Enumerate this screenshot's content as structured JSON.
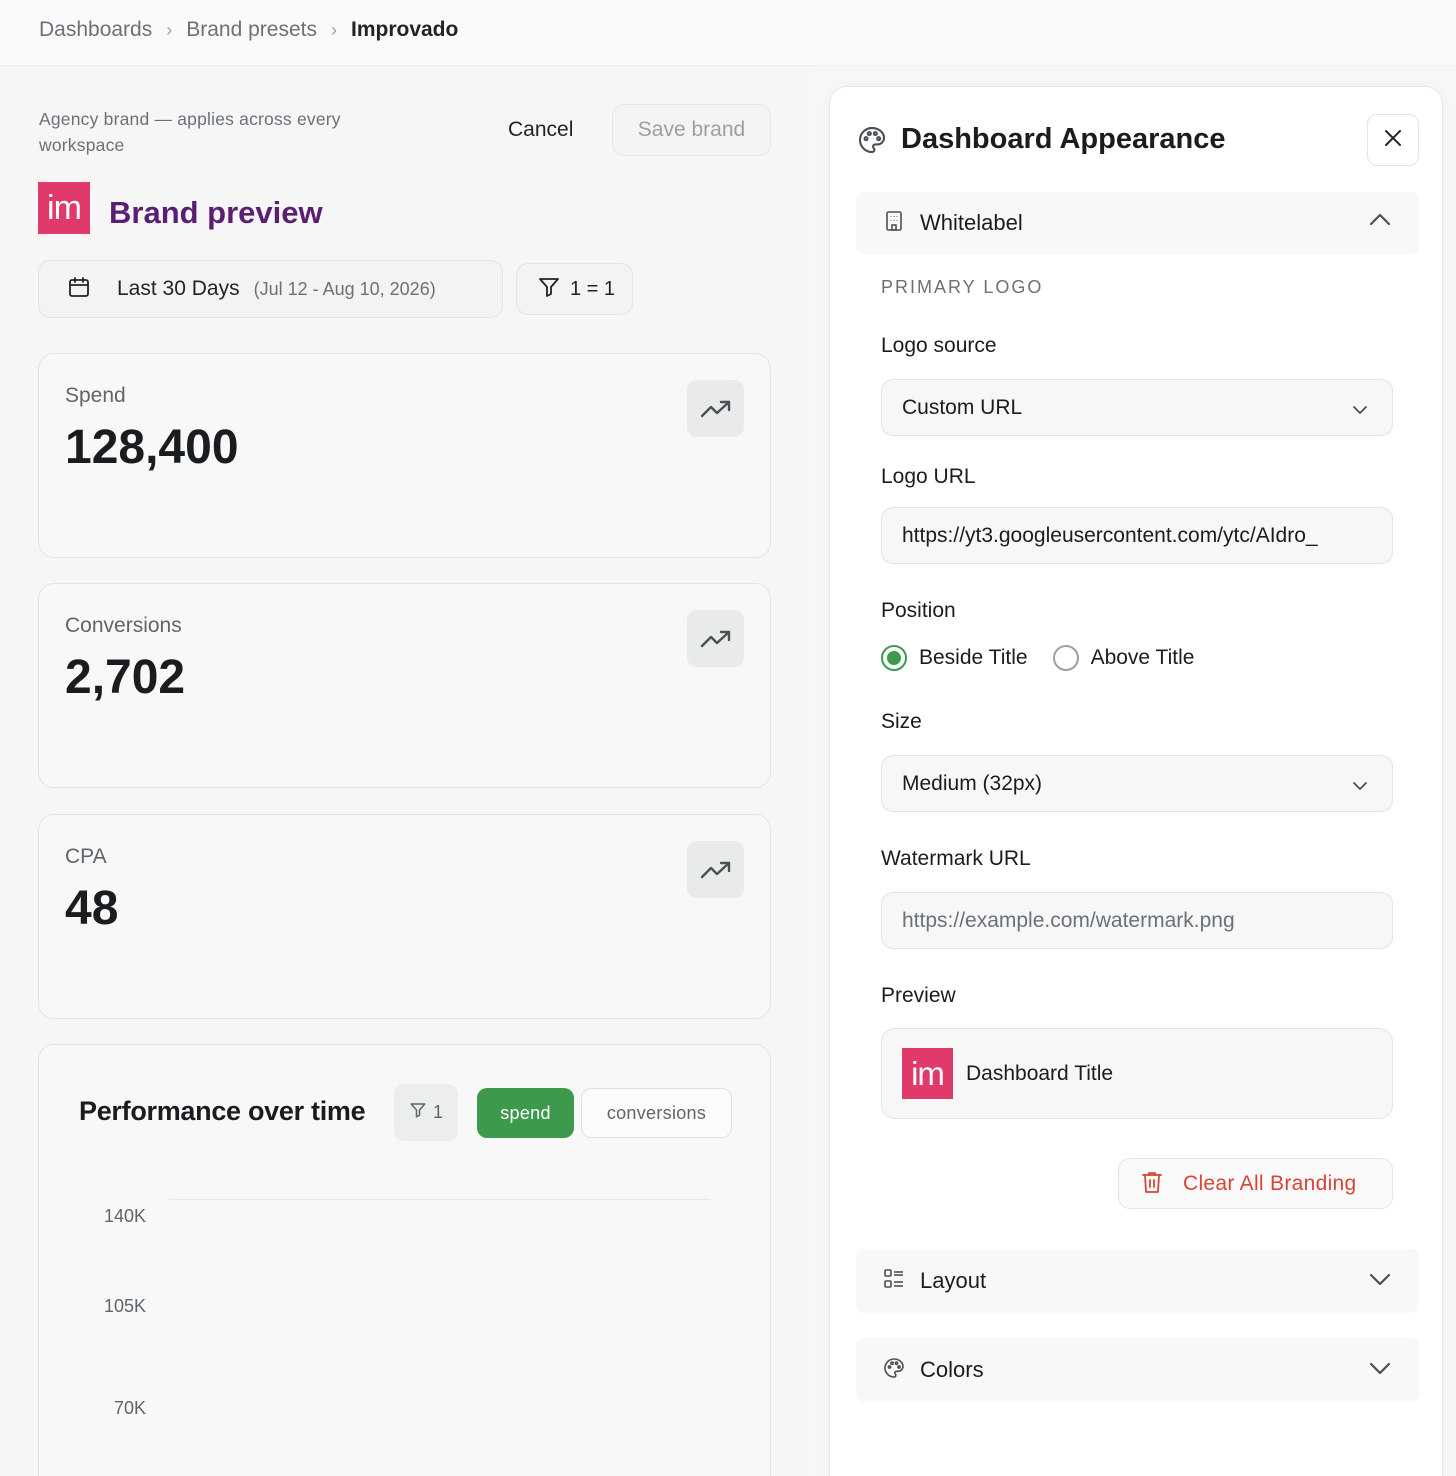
{
  "breadcrumb": [
    "Dashboards",
    "Brand presets",
    "Improvado"
  ],
  "editor": {
    "subtitle": "Agency brand — applies across every workspace",
    "cancel_label": "Cancel",
    "save_label": "Save brand",
    "logo_text": "im",
    "brand_title": "Brand preview",
    "date_label": "Last 30 Days",
    "date_range": "(Jul 12 - Aug 10, 2026)",
    "filter_label": "1 = 1"
  },
  "kpis": [
    {
      "label": "Spend",
      "value": "128,400"
    },
    {
      "label": "Conversions",
      "value": "2,702"
    },
    {
      "label": "CPA",
      "value": "48"
    }
  ],
  "chart": {
    "title": "Performance over time",
    "filter_count": "1",
    "toggle_spend": "spend",
    "toggle_conversions": "conversions"
  },
  "chart_data": {
    "type": "line",
    "title": "Performance over time",
    "y_ticks": [
      "140K",
      "105K",
      "70K"
    ],
    "series": [
      {
        "name": "spend",
        "active": true,
        "values": []
      },
      {
        "name": "conversions",
        "active": false,
        "values": []
      }
    ]
  },
  "panel": {
    "title": "Dashboard Appearance",
    "whitelabel_label": "Whitelabel",
    "eyebrow": "PRIMARY LOGO",
    "logo_source_label": "Logo source",
    "logo_source_value": "Custom URL",
    "logo_url_label": "Logo URL",
    "logo_url_value": "https://yt3.googleusercontent.com/ytc/AIdro_",
    "position_label": "Position",
    "position_options": [
      "Beside Title",
      "Above Title"
    ],
    "position_selected": "Beside Title",
    "size_label": "Size",
    "size_value": "Medium (32px)",
    "watermark_label": "Watermark URL",
    "watermark_placeholder": "https://example.com/watermark.png",
    "preview_label": "Preview",
    "preview_logo_text": "im",
    "preview_title": "Dashboard Title",
    "clear_label": "Clear All Branding",
    "layout_label": "Layout",
    "colors_label": "Colors"
  },
  "colors": {
    "accent_green": "#3d9a4c",
    "brand_pink": "#e03a6b",
    "brand_purple": "#5a1f73",
    "danger_red": "#d94436"
  }
}
